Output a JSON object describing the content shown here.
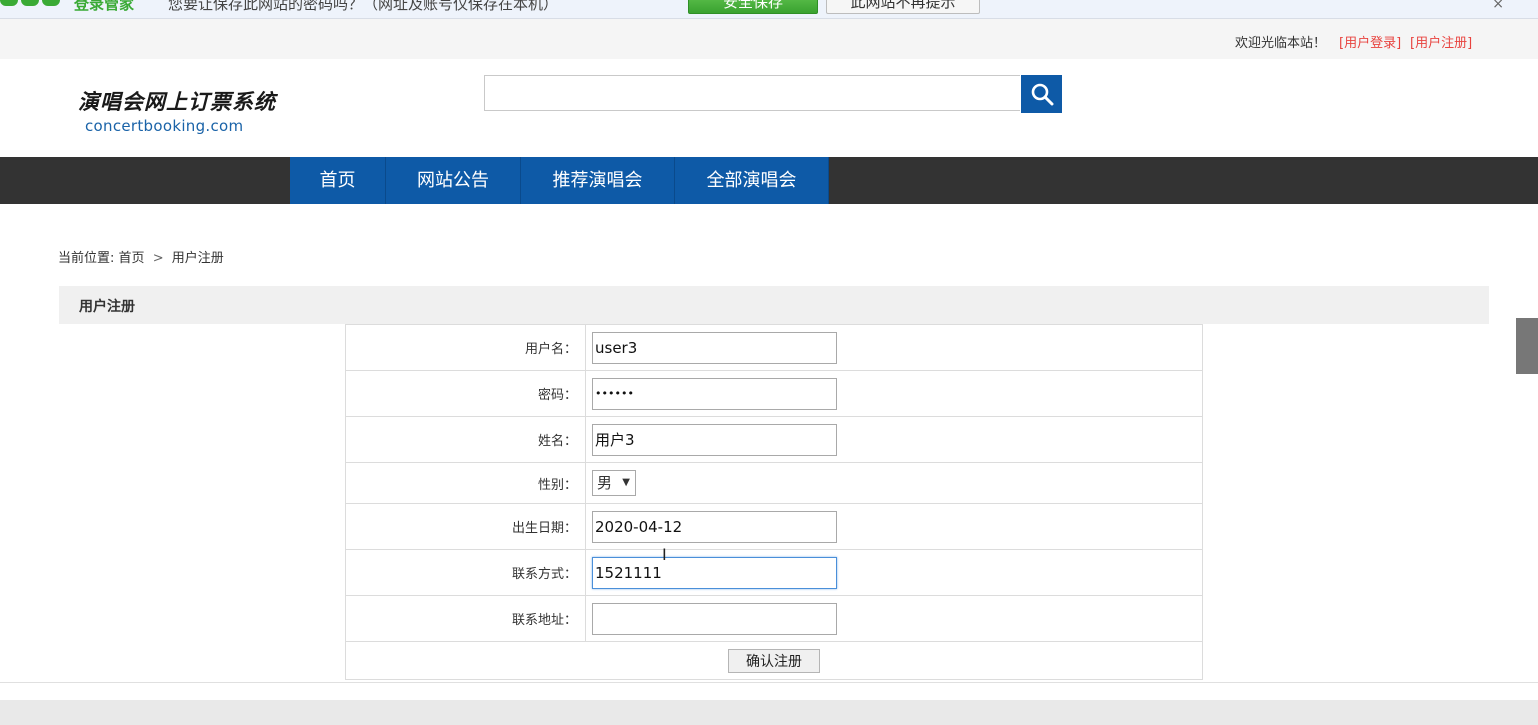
{
  "browser_notice": {
    "brand": "登录管家",
    "message": "您要让保存此网站的密码吗？（网址及账号仅保存在本机）",
    "save_label": "安全保存",
    "dismiss_label": "此网站不再提示",
    "close_glyph": "×"
  },
  "topbar": {
    "welcome": "欢迎光临本站！",
    "login_link": "[用户登录]",
    "register_link": "[用户注册]"
  },
  "header": {
    "logo_cn": "演唱会网上订票系统",
    "logo_en": "concertbooking.com",
    "search_placeholder": "",
    "search_icon": "search-icon"
  },
  "nav": {
    "items": [
      {
        "label": "首页"
      },
      {
        "label": "网站公告"
      },
      {
        "label": "推荐演唱会"
      },
      {
        "label": "全部演唱会"
      }
    ]
  },
  "breadcrumb": {
    "prefix": "当前位置:",
    "home": "首页",
    "separator": ">",
    "current": "用户注册"
  },
  "section": {
    "title": "用户注册"
  },
  "form": {
    "username_label": "用户名：",
    "username_value": "user3",
    "password_label": "密码：",
    "password_value": "123456",
    "name_label": "姓名：",
    "name_value": "用户3",
    "gender_label": "性别：",
    "gender_value": "男",
    "birthday_label": "出生日期：",
    "birthday_value": "2020-04-12",
    "contact_label": "联系方式：",
    "contact_value": "1521111",
    "address_label": "联系地址：",
    "address_value": "",
    "submit_label": "确认注册"
  },
  "colors": {
    "brand_blue": "#0e5aa7",
    "nav_dark": "#333333",
    "link_red": "#e8433f",
    "notice_green": "#3aaa35"
  }
}
